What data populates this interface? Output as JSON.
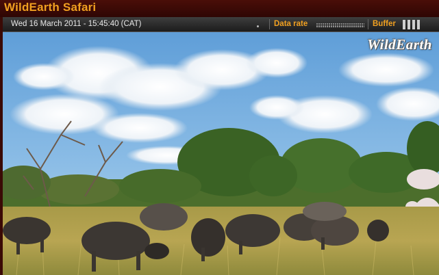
{
  "app": {
    "title": "WildEarth Safari"
  },
  "statusbar": {
    "timestamp": "Wed 16 March 2011 - 15:45:40 (CAT)",
    "data_rate_label": "Data rate",
    "buffer_label": "Buffer",
    "buffer_level": 4
  },
  "video": {
    "watermark": "WildEarth",
    "description_icon": "live-camera-feed"
  },
  "colors": {
    "accent": "#f0a020",
    "titlebar": "#3a0a05",
    "statusbar": "#2a2a2a"
  }
}
